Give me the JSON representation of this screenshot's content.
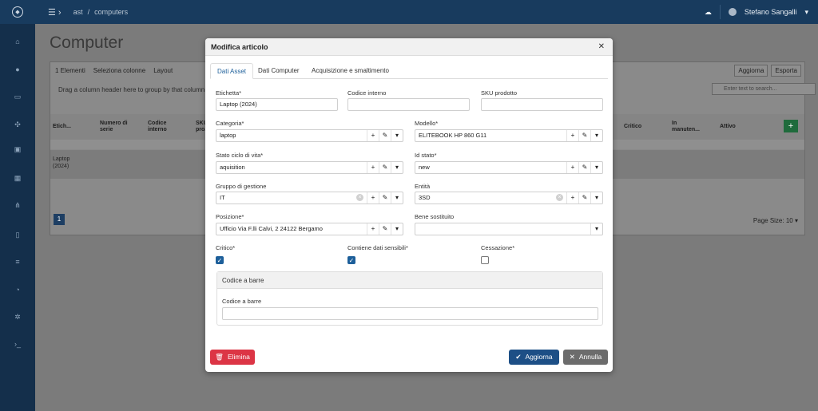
{
  "topbar": {
    "breadcrumb_root": "ast",
    "breadcrumb_sep": "/",
    "breadcrumb_page": "computers",
    "user_name": "Stefano Sangalli"
  },
  "page": {
    "title": "Computer"
  },
  "grid": {
    "toolbar": {
      "items_count": "1 Elementi",
      "select_columns": "Seleziona colonne",
      "layout": "Layout",
      "refresh": "Aggiorna",
      "export": "Esporta"
    },
    "group_hint": "Drag a column header here to group by that column",
    "search_placeholder": "Enter text to search...",
    "headers": {
      "label": "Etich...",
      "serial": "Numero di serie",
      "internal_code": "Codice interno",
      "sku": "SKU pro...",
      "critical": "Critico",
      "maintenance": "In manuten...",
      "active": "Attivo"
    },
    "row": {
      "label": "Laptop",
      "label_year": "(2024)"
    },
    "page_number": "1",
    "page_size_label": "Page Size:",
    "page_size_value": "10"
  },
  "modal": {
    "title": "Modifica articolo",
    "tabs": [
      {
        "label": "Dati Asset"
      },
      {
        "label": "Dati Computer"
      },
      {
        "label": "Acquisizione e smaltimento"
      }
    ],
    "fields": {
      "etichetta": {
        "label": "Etichetta*",
        "value": "Laptop (2024)"
      },
      "codice_interno": {
        "label": "Codice interno",
        "value": ""
      },
      "sku": {
        "label": "SKU prodotto",
        "value": ""
      },
      "categoria": {
        "label": "Categoria*",
        "value": "laptop"
      },
      "modello": {
        "label": "Modello*",
        "value": "ELITEBOOK HP 860 G11"
      },
      "stato": {
        "label": "Stato ciclo di vita*",
        "value": "aquisition"
      },
      "id_stato": {
        "label": "Id stato*",
        "value": "new"
      },
      "gruppo": {
        "label": "Gruppo di gestione",
        "value": "IT"
      },
      "entita": {
        "label": "Entità",
        "value": "3SD"
      },
      "posizione": {
        "label": "Posizione*",
        "value": "Ufficio Via F.lli Calvi, 2 24122 Bergamo"
      },
      "bene_sostituito": {
        "label": "Bene sostituito",
        "value": ""
      },
      "critico": {
        "label": "Critico*",
        "checked": true
      },
      "dati_sensibili": {
        "label": "Contiene dati sensibili*",
        "checked": true
      },
      "cessazione": {
        "label": "Cessazione*",
        "checked": false
      }
    },
    "barcode": {
      "section_title": "Codice a barre",
      "field_label": "Codice a barre",
      "value": ""
    },
    "buttons": {
      "delete": "Elimina",
      "update": "Aggiorna",
      "cancel": "Annulla"
    }
  },
  "icons": [
    "logo-icon",
    "menu-toggle-icon",
    "cloud-icon",
    "chevron-down-icon",
    "plus-icon",
    "pencil-icon",
    "clear-icon",
    "check-icon",
    "trash-icon",
    "close-icon",
    "search-icon",
    "filter-icon",
    "sort-icon"
  ],
  "colors": {
    "topbar": "#183b5e",
    "primary": "#1d4f86",
    "danger": "#dc3545",
    "secondary": "#6c6c6c",
    "add_green": "#1f6b3c"
  }
}
